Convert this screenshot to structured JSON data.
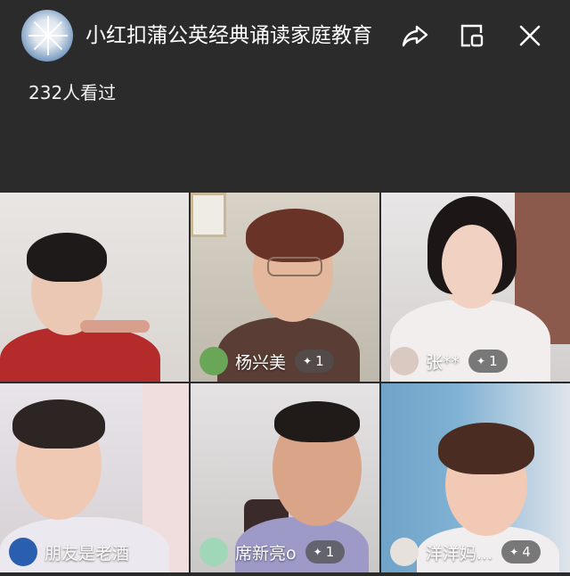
{
  "header": {
    "title": "小红扣蒲公英经典诵读家庭教育",
    "views": "232人看过"
  },
  "participants": [
    {
      "name": "",
      "badge": ""
    },
    {
      "name": "杨兴美",
      "badge": "1"
    },
    {
      "name": "张**",
      "badge": "1"
    },
    {
      "name": "朋友是老酒",
      "badge": ""
    },
    {
      "name": "席新亮o",
      "badge": "1"
    },
    {
      "name": "洋洋妈...",
      "badge": "4"
    }
  ],
  "colors": {
    "background": "#2b2b2b",
    "text": "#ffffff",
    "badge_bg": "#505050"
  },
  "icons": [
    "share-icon",
    "mini-window-icon",
    "close-icon",
    "star-icon"
  ]
}
